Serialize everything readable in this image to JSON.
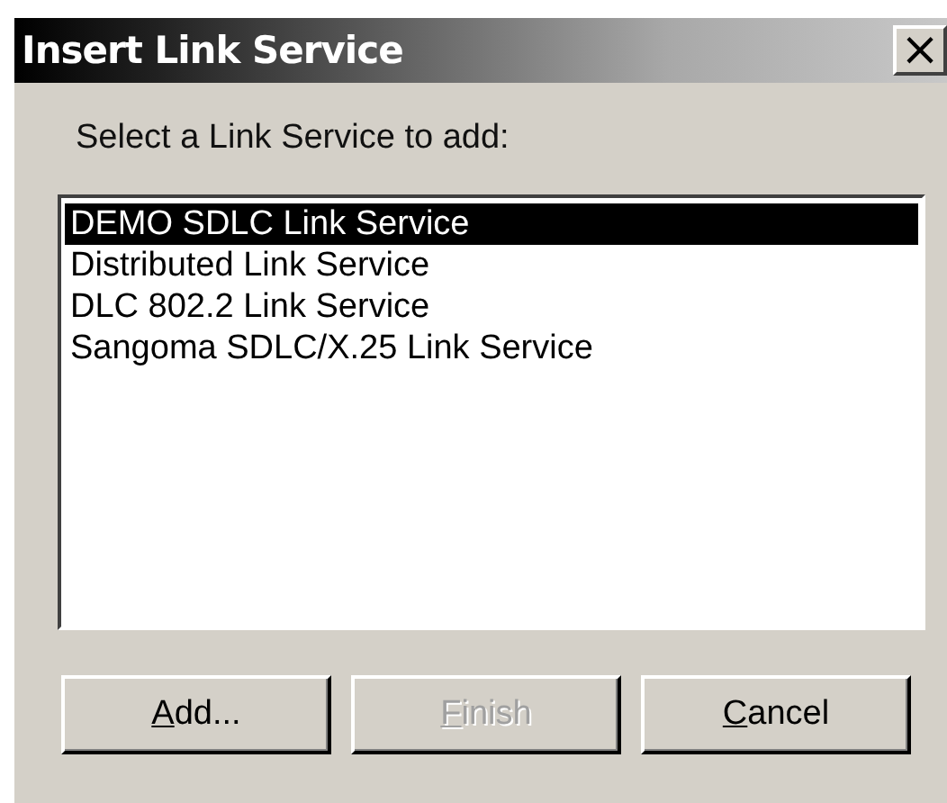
{
  "window": {
    "title": "Insert Link Service",
    "close_glyph": "×"
  },
  "prompt": "Select a Link Service to add:",
  "services": [
    {
      "label": "DEMO SDLC Link Service",
      "selected": true
    },
    {
      "label": "Distributed Link Service",
      "selected": false
    },
    {
      "label": "DLC 802.2 Link Service",
      "selected": false
    },
    {
      "label": "Sangoma SDLC/X.25 Link Service",
      "selected": false
    }
  ],
  "buttons": [
    {
      "label": "Add...",
      "disabled": false,
      "access_key_underlined": true
    },
    {
      "label": "Finish",
      "disabled": true,
      "access_key_underlined": true
    },
    {
      "label": "Cancel",
      "disabled": false,
      "access_key_underlined": true
    }
  ]
}
